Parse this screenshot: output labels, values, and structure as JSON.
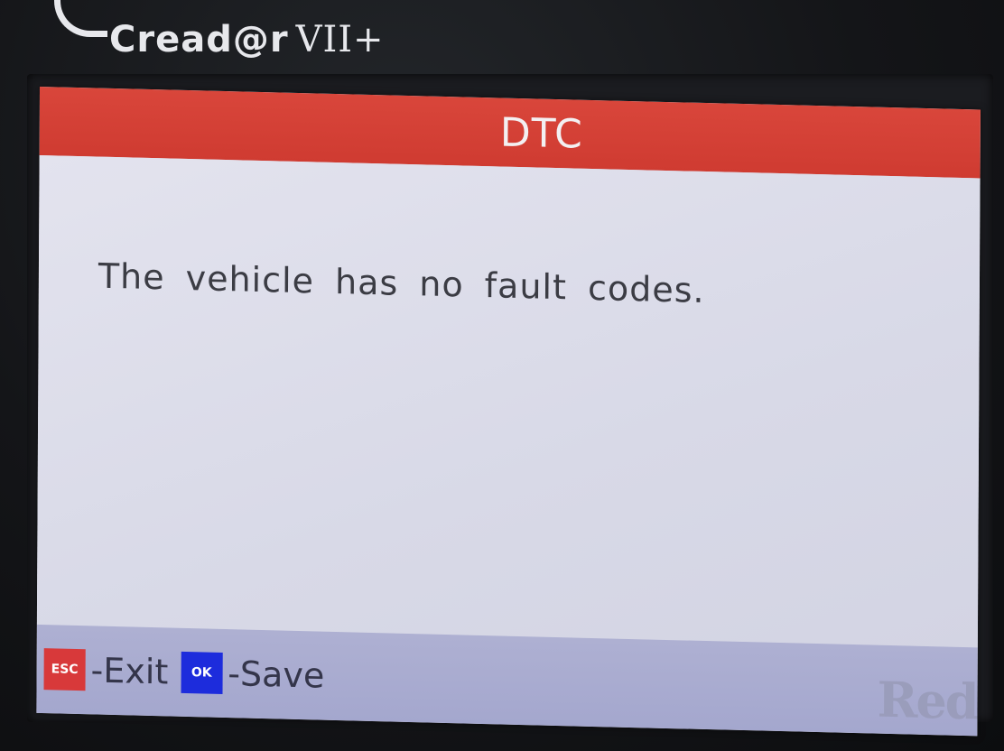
{
  "device": {
    "brand_name": "Cread@r",
    "model": "VII+"
  },
  "screen": {
    "title": "DTC",
    "message": "The vehicle has no fault codes.",
    "footer": {
      "esc_key": "ESC",
      "esc_label": "-Exit",
      "ok_key": "OK",
      "ok_label": "-Save"
    },
    "watermark": "Red"
  },
  "colors": {
    "title_bar": "#d9463b",
    "screen_background": "#dcdde8",
    "footer_bar": "#aeb0d2",
    "esc_key": "#d8393a",
    "ok_key": "#1d2cdc"
  }
}
